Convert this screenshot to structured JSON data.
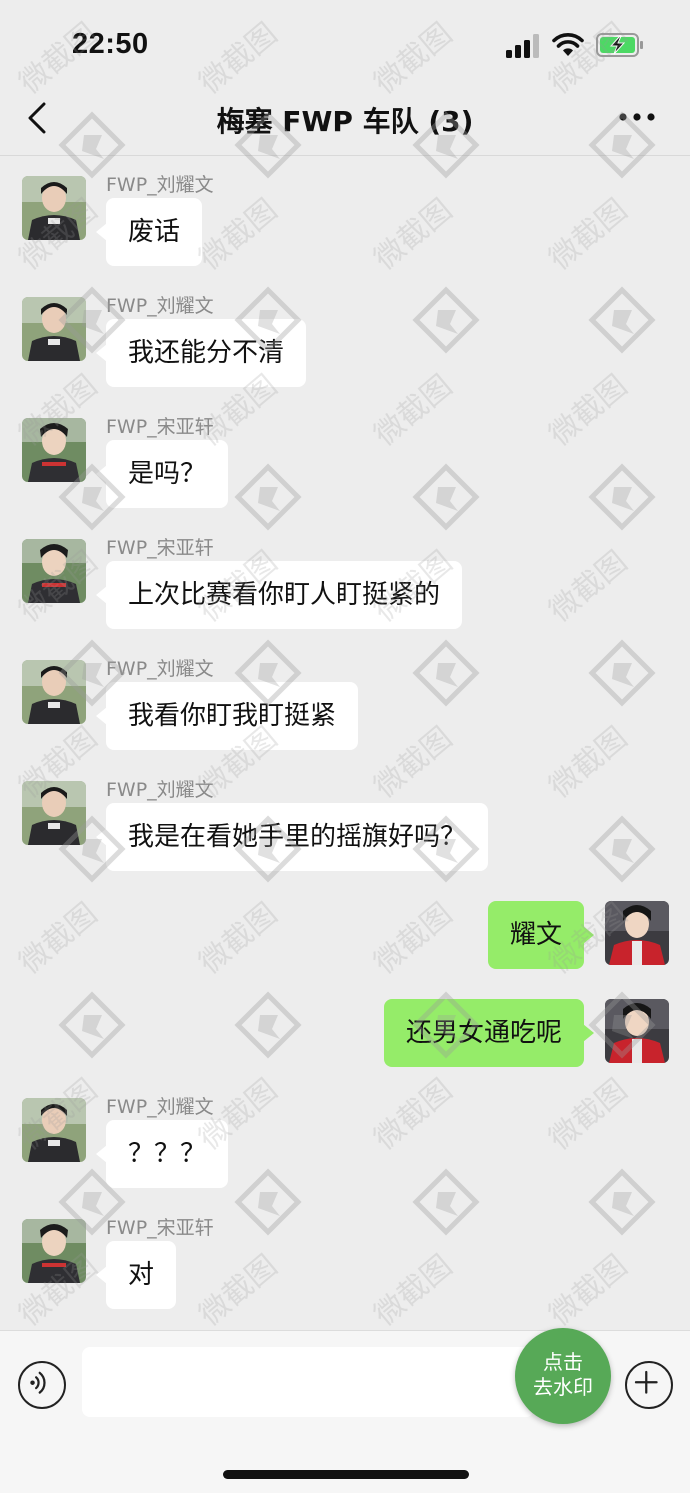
{
  "status_bar": {
    "time": "22:50",
    "icons": [
      "cellular-signal-icon",
      "wifi-icon",
      "battery-charging-icon"
    ]
  },
  "nav": {
    "title": "梅塞 FWP 车队 (3)",
    "back_icon": "chevron-left-icon",
    "more_icon": "more-dots-icon"
  },
  "messages": [
    {
      "side": "left",
      "sender": "FWP_刘耀文",
      "text": "废话",
      "avatar": "avatar-liu-yaowen"
    },
    {
      "side": "left",
      "sender": "FWP_刘耀文",
      "text": "我还能分不清",
      "avatar": "avatar-liu-yaowen"
    },
    {
      "side": "left",
      "sender": "FWP_宋亚轩",
      "text": "是吗？",
      "avatar": "avatar-song-yaxuan"
    },
    {
      "side": "left",
      "sender": "FWP_宋亚轩",
      "text": "上次比赛看你盯人盯挺紧的",
      "avatar": "avatar-song-yaxuan"
    },
    {
      "side": "left",
      "sender": "FWP_刘耀文",
      "text": "我看你盯我盯挺紧",
      "avatar": "avatar-liu-yaowen"
    },
    {
      "side": "left",
      "sender": "FWP_刘耀文",
      "text": "我是在看她手里的摇旗好吗？",
      "avatar": "avatar-liu-yaowen"
    },
    {
      "side": "right",
      "sender": "",
      "text": "耀文",
      "avatar": "avatar-self"
    },
    {
      "side": "right",
      "sender": "",
      "text": "还男女通吃呢",
      "avatar": "avatar-self"
    },
    {
      "side": "left",
      "sender": "FWP_刘耀文",
      "text": "？？？",
      "avatar": "avatar-liu-yaowen"
    },
    {
      "side": "left",
      "sender": "FWP_宋亚轩",
      "text": "对",
      "avatar": "avatar-song-yaxuan"
    }
  ],
  "input_bar": {
    "placeholder": "",
    "voice_icon": "voice-icon",
    "plus_icon": "plus-icon"
  },
  "watermark_button": {
    "line1": "点击",
    "line2": "去水印"
  },
  "watermark_text": "微截图",
  "colors": {
    "background": "#ededed",
    "outgoing_bubble": "#95ec69",
    "incoming_bubble": "#ffffff",
    "watermark_button": "#57a957"
  }
}
